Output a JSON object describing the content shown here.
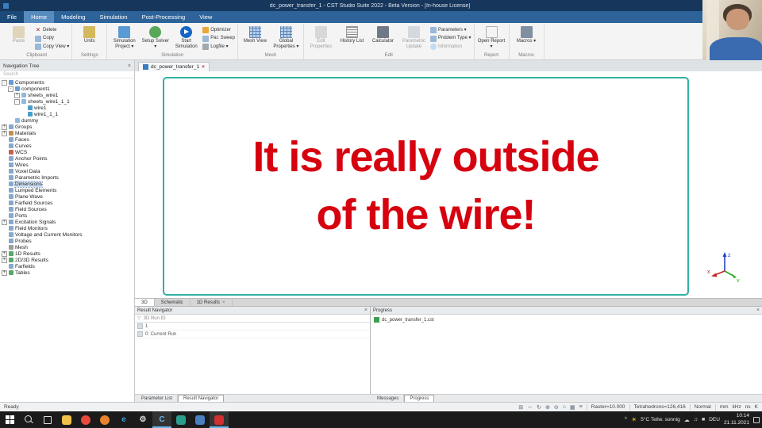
{
  "titlebar": {
    "title": "dc_power_transfer_1 - CST Studio Suite 2022 - Beta Version - [In-house License]",
    "window_buttons": [
      {
        "name": "minimize",
        "glyph": "─"
      },
      {
        "name": "maximize",
        "glyph": "□"
      },
      {
        "name": "close",
        "glyph": "×"
      }
    ]
  },
  "menubar": {
    "tabs": [
      {
        "label": "File",
        "style": "file"
      },
      {
        "label": "Home",
        "style": "active"
      },
      {
        "label": "Modeling"
      },
      {
        "label": "Simulation"
      },
      {
        "label": "Post-Processing"
      },
      {
        "label": "View"
      }
    ]
  },
  "ribbon": {
    "groups": [
      {
        "name": "Clipboard",
        "items": [
          {
            "name": "paste",
            "label": "Paste",
            "size": "big",
            "disabled": true
          },
          {
            "name": "delete",
            "label": "Delete",
            "size": "small",
            "glyph": "×"
          },
          {
            "name": "copy",
            "label": "Copy",
            "size": "small"
          },
          {
            "name": "copy-view",
            "label": "Copy View",
            "size": "small",
            "arrow": true
          }
        ]
      },
      {
        "name": "Settings",
        "items": [
          {
            "name": "units",
            "label": "Units",
            "size": "big"
          }
        ]
      },
      {
        "name": "Simulation",
        "items": [
          {
            "name": "simulation-project",
            "label": "Simulation Project",
            "size": "big",
            "arrow": true
          },
          {
            "name": "setup-solver",
            "label": "Setup Solver",
            "size": "big",
            "arrow": true
          },
          {
            "name": "start-simulation",
            "label": "Start Simulation",
            "size": "big"
          },
          {
            "name": "optimizer",
            "label": "Optimizer",
            "size": "small"
          },
          {
            "name": "par-sweep",
            "label": "Par. Sweep",
            "size": "small"
          },
          {
            "name": "logfile",
            "label": "Logfile",
            "size": "small",
            "arrow": true
          }
        ]
      },
      {
        "name": "Mesh",
        "items": [
          {
            "name": "mesh-view",
            "label": "Mesh View",
            "size": "big"
          },
          {
            "name": "global-properties",
            "label": "Global Properties",
            "size": "big",
            "arrow": true
          }
        ]
      },
      {
        "name": "Edit",
        "items": [
          {
            "name": "edit-properties",
            "label": "Edit Properties",
            "size": "big",
            "disabled": true
          },
          {
            "name": "history-list",
            "label": "History List",
            "size": "big"
          },
          {
            "name": "calculator",
            "label": "Calculator",
            "size": "big"
          },
          {
            "name": "parametric-update",
            "label": "Parametric Update",
            "size": "big",
            "disabled": true
          },
          {
            "name": "parameters",
            "label": "Parameters",
            "size": "small",
            "arrow": true
          },
          {
            "name": "problem-type",
            "label": "Problem Type",
            "size": "small",
            "arrow": true
          },
          {
            "name": "information",
            "label": "Information",
            "size": "small",
            "disabled": true
          }
        ]
      },
      {
        "name": "Report",
        "items": [
          {
            "name": "open-report",
            "label": "Open Report",
            "size": "big",
            "arrow": true
          }
        ]
      },
      {
        "name": "Macros",
        "items": [
          {
            "name": "macros",
            "label": "Macros",
            "size": "big",
            "arrow": true
          }
        ]
      }
    ]
  },
  "doc_tab": {
    "label": "dc_power_transfer_1",
    "close": "×"
  },
  "nav_tree": {
    "title": "Navigation Tree",
    "close": "×",
    "search_placeholder": "Search",
    "items": [
      {
        "label": "Components",
        "level": 0,
        "exp": "minus",
        "icon": "components"
      },
      {
        "label": "component1",
        "level": 1,
        "exp": "minus",
        "icon": "component"
      },
      {
        "label": "sheets_wire1",
        "level": 2,
        "exp": "plus",
        "icon": "solid"
      },
      {
        "label": "sheets_wire1_1_1",
        "level": 2,
        "exp": "minus",
        "icon": "solid"
      },
      {
        "label": "wire1",
        "level": 3,
        "exp": "none",
        "icon": "wire"
      },
      {
        "label": "wire1_1_1",
        "level": 3,
        "exp": "none",
        "icon": "wire"
      },
      {
        "label": "dummy",
        "level": 1,
        "exp": "none",
        "icon": "solid"
      },
      {
        "label": "Groups",
        "level": 0,
        "exp": "plus",
        "icon": "folder"
      },
      {
        "label": "Materials",
        "level": 0,
        "exp": "plus",
        "icon": "materials"
      },
      {
        "label": "Faces",
        "level": 0,
        "exp": "none",
        "icon": "folder"
      },
      {
        "label": "Curves",
        "level": 0,
        "exp": "none",
        "icon": "folder"
      },
      {
        "label": "WCS",
        "level": 0,
        "exp": "none",
        "icon": "wcs"
      },
      {
        "label": "Anchor Points",
        "level": 0,
        "exp": "none",
        "icon": "folder"
      },
      {
        "label": "Wires",
        "level": 0,
        "exp": "none",
        "icon": "folder"
      },
      {
        "label": "Voxel Data",
        "level": 0,
        "exp": "none",
        "icon": "folder"
      },
      {
        "label": "Parametric Imports",
        "level": 0,
        "exp": "none",
        "icon": "folder"
      },
      {
        "label": "Dimensions",
        "level": 0,
        "exp": "none",
        "icon": "folder",
        "selected": true
      },
      {
        "label": "Lumped Elements",
        "level": 0,
        "exp": "none",
        "icon": "folder"
      },
      {
        "label": "Plane Wave",
        "level": 0,
        "exp": "none",
        "icon": "folder"
      },
      {
        "label": "Farfield Sources",
        "level": 0,
        "exp": "none",
        "icon": "folder"
      },
      {
        "label": "Field Sources",
        "level": 0,
        "exp": "none",
        "icon": "folder"
      },
      {
        "label": "Ports",
        "level": 0,
        "exp": "none",
        "icon": "folder"
      },
      {
        "label": "Excitation Signals",
        "level": 0,
        "exp": "plus",
        "icon": "folder"
      },
      {
        "label": "Field Monitors",
        "level": 0,
        "exp": "none",
        "icon": "folder"
      },
      {
        "label": "Voltage and Current Monitors",
        "level": 0,
        "exp": "none",
        "icon": "folder"
      },
      {
        "label": "Probes",
        "level": 0,
        "exp": "none",
        "icon": "folder"
      },
      {
        "label": "Mesh",
        "level": 0,
        "exp": "none",
        "icon": "mesh"
      },
      {
        "label": "1D Results",
        "level": 0,
        "exp": "plus",
        "icon": "results"
      },
      {
        "label": "2D/3D Results",
        "level": 0,
        "exp": "plus",
        "icon": "results"
      },
      {
        "label": "Farfields",
        "level": 0,
        "exp": "none",
        "icon": "folder"
      },
      {
        "label": "Tables",
        "level": 0,
        "exp": "plus",
        "icon": "results"
      }
    ]
  },
  "canvas": {
    "slide_lines": [
      "It is really outside",
      "of the wire!"
    ],
    "text_color": "#d6020f",
    "border_color": "#2fb2a2",
    "axes_labels": {
      "x": "x",
      "y": "y",
      "z": "z"
    }
  },
  "view_tabs": [
    {
      "label": "3D",
      "active": true
    },
    {
      "label": "Schematic"
    },
    {
      "label": "1D Results",
      "close": "×"
    }
  ],
  "result_navigator": {
    "title": "Result Navigator",
    "close": "×",
    "filter_icon": "▽",
    "filter_label": "3D Run ID",
    "rows": [
      {
        "label": "1"
      },
      {
        "label": "0: Current Run"
      }
    ]
  },
  "progress_panel": {
    "title": "Progress",
    "close": "×",
    "file": "dc_power_transfer_1.cst"
  },
  "bottom_tabs": {
    "left": [
      {
        "label": "Parameter List"
      },
      {
        "label": "Result Navigator",
        "active": true
      }
    ],
    "right": [
      {
        "label": "Messages"
      },
      {
        "label": "Progress",
        "active": true
      }
    ]
  },
  "statusbar": {
    "ready": "Ready",
    "icons": [
      {
        "name": "select-icon",
        "glyph": "⊞"
      },
      {
        "name": "pan-icon",
        "glyph": "↔"
      },
      {
        "name": "rotate-icon",
        "glyph": "↻"
      },
      {
        "name": "zoom-in-icon",
        "glyph": "⊕"
      },
      {
        "name": "zoom-out-icon",
        "glyph": "⊖"
      },
      {
        "name": "fit-view-icon",
        "glyph": "⌂"
      },
      {
        "name": "grid-icon",
        "glyph": "▦"
      },
      {
        "name": "list-icon",
        "glyph": "≡"
      }
    ],
    "fields": [
      "Raster=10.000",
      "Tetrahedrons=126,416",
      "Normal"
    ],
    "units": [
      "mm",
      "kHz",
      "ns",
      "K"
    ]
  },
  "taskbar": {
    "icons": [
      {
        "name": "start",
        "type": "start"
      },
      {
        "name": "search",
        "type": "search"
      },
      {
        "name": "task-view",
        "type": "taskview"
      },
      {
        "name": "file-explorer",
        "color": "#f2c14a"
      },
      {
        "name": "browser-chrome",
        "color": "#e84b3c",
        "round": true
      },
      {
        "name": "browser-firefox",
        "color": "#e8822c",
        "round": true
      },
      {
        "name": "edge-browser",
        "glyph": "e",
        "color": "#3aa0dc"
      },
      {
        "name": "settings",
        "glyph": "⚙",
        "color": "#d8d8d8"
      },
      {
        "name": "cst-studio",
        "glyph": "C",
        "color": "#6cb4e8",
        "active": true
      },
      {
        "name": "teal-app",
        "color": "#2a9d8f"
      },
      {
        "name": "blue-app",
        "color": "#4a7fc0"
      },
      {
        "name": "red-recorder-app",
        "color": "#d03030",
        "active": true
      }
    ],
    "tray": {
      "chevron": "^",
      "weather_icon": "☀",
      "weather_text": "5°C  Teilw. sonnig",
      "tray_icons": [
        "☁",
        "♫",
        "■"
      ],
      "lang": "DEU",
      "time": "10:14",
      "date": "21.11.2021"
    }
  }
}
